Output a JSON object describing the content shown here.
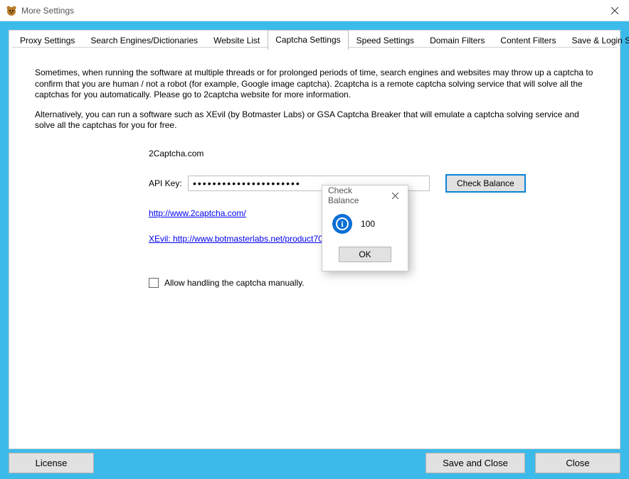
{
  "window": {
    "title": "More Settings"
  },
  "tabs": [
    {
      "label": "Proxy Settings"
    },
    {
      "label": "Search Engines/Dictionaries"
    },
    {
      "label": "Website List"
    },
    {
      "label": "Captcha Settings"
    },
    {
      "label": "Speed Settings"
    },
    {
      "label": "Domain Filters"
    },
    {
      "label": "Content Filters"
    },
    {
      "label": "Save & Login Settings"
    }
  ],
  "desc": {
    "p1": "Sometimes, when running the software at multiple threads or for prolonged periods of time, search engines and websites may throw up a captcha to confirm that you are human / not a robot (for example, Google image captcha). 2captcha is a remote captcha solving service that will solve all the captchas for you automatically. Please go to 2captcha website for more information.",
    "p2": "Alternatively, you can run a software such as XEvil (by Botmaster Labs) or GSA Captcha Breaker that will emulate a captcha solving service and solve all the captchas for you for free."
  },
  "form": {
    "section_label": "2Captcha.com",
    "api_key_label": "API Key:",
    "api_key_value": "••••••••••••••••••••••",
    "check_balance_btn": "Check Balance",
    "link1": "http://www.2captcha.com/",
    "link2": "XEvil: http://www.botmasterlabs.net/product70741/",
    "allow_manual_label": "Allow handling the captcha manually."
  },
  "bottom": {
    "license": "License",
    "save": "Save and Close",
    "close": "Close"
  },
  "dialog": {
    "title": "Check Balance",
    "value": "100",
    "ok": "OK"
  }
}
